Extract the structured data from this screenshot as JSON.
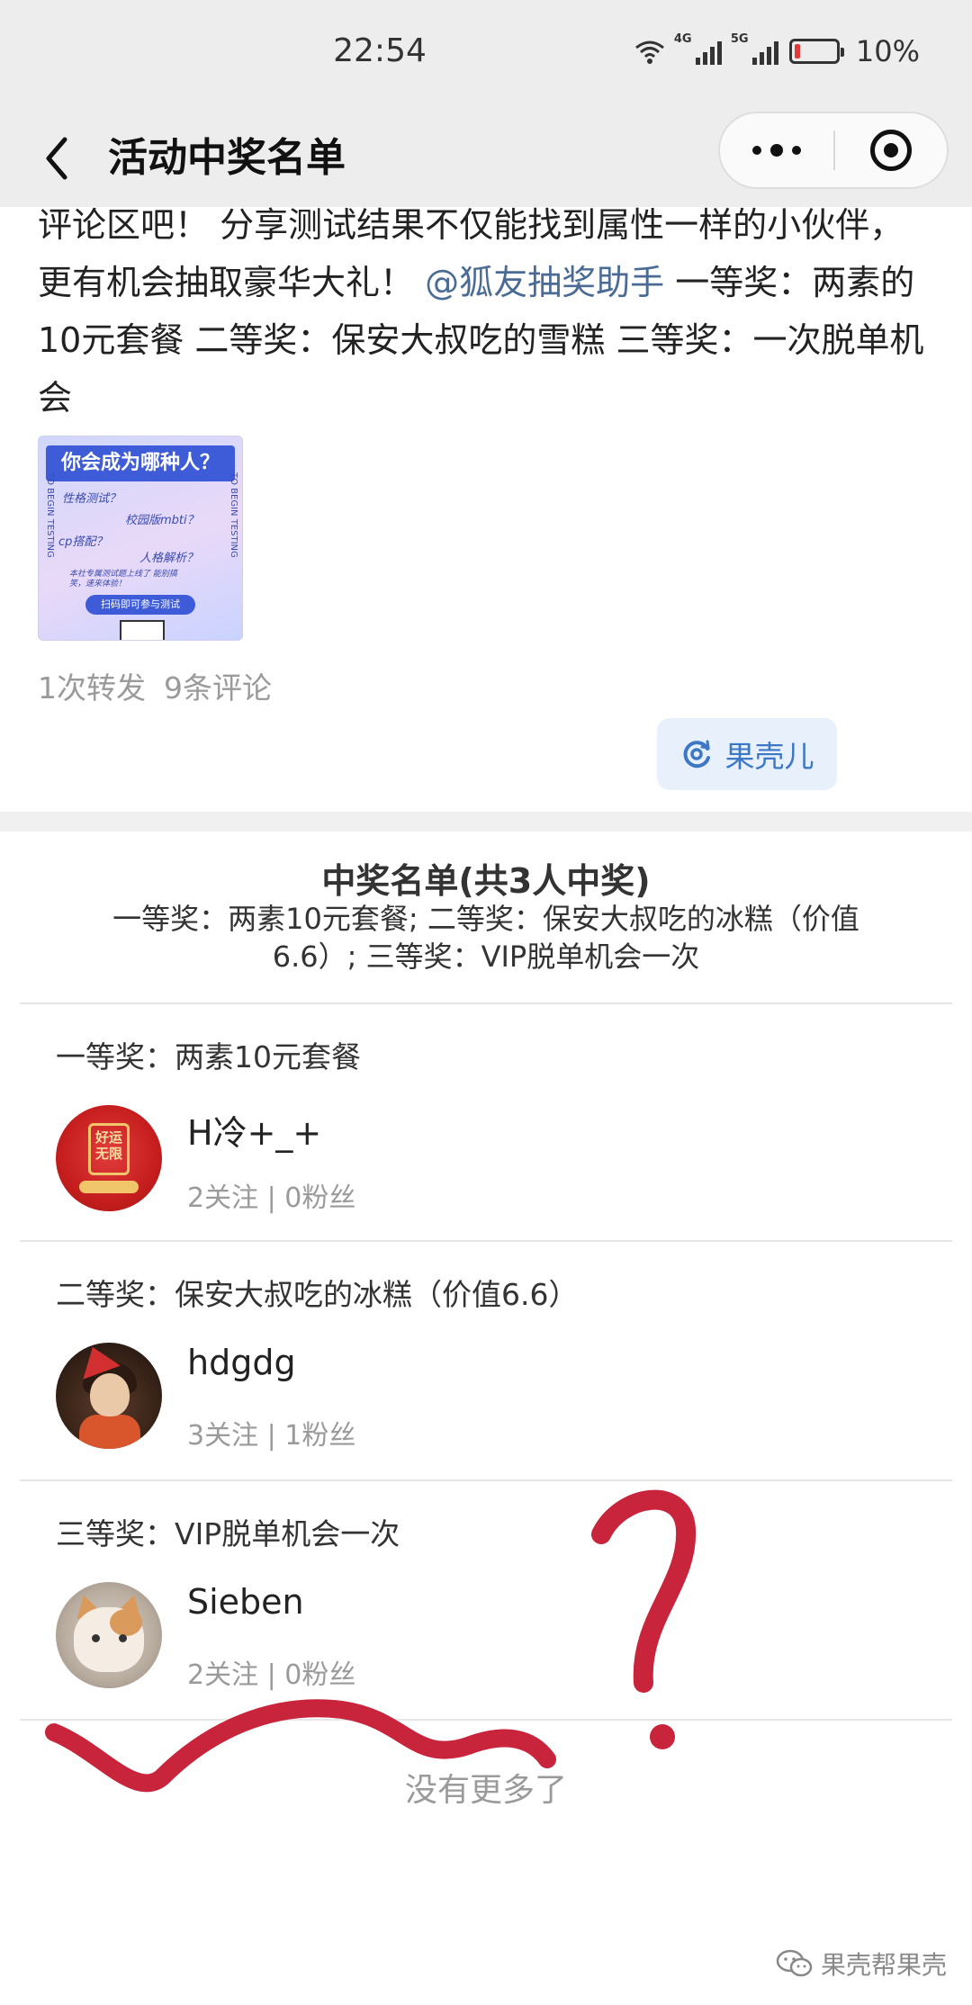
{
  "status_bar": {
    "time": "22:54",
    "signal1": "4G",
    "signal2": "5G",
    "battery": "10%",
    "battery_level": 0.1
  },
  "navbar": {
    "title": "活动中奖名单",
    "back_icon": "chevron-left-icon",
    "more_icon": "more-dots-icon",
    "close_icon": "target-icon"
  },
  "post": {
    "text_before": "评论区吧！ 分享测试结果不仅能找到属性一样的小伙伴，更有机会抽取豪华大礼！ ",
    "mention": "@狐友抽奖助手",
    "text_after": " 一等奖：两素的10元套餐 二等奖：保安大叔吃的雪糕 三等奖：一次脱单机会",
    "image": {
      "title": "你会成为哪种人？",
      "line1": "性格测试？",
      "line2": "校园版mbti？",
      "line3": "cp搭配？",
      "line4": "人格解析？",
      "side_left": "TO BEGIN TESTING",
      "side_right": "TO BEGIN TESTING",
      "note": "本社专属测试题上线了 能别搞笑，速来体验！",
      "button": "扫码即可参与测试"
    },
    "reposts": "1次转发",
    "comments": "9条评论",
    "tag": "果壳儿",
    "tag_icon": "refresh-icon"
  },
  "winners": {
    "title": "中奖名单(共3人中奖)",
    "summary": "一等奖：两素10元套餐; 二等奖：保安大叔吃的冰糕（价值6.6）; 三等奖：VIP脱单机会一次",
    "items": [
      {
        "prize": "一等奖：两素10元套餐",
        "name": "H冷+_+",
        "stats": "2关注 | 0粉丝",
        "avatar_text": "好运无限"
      },
      {
        "prize": "二等奖：保安大叔吃的冰糕（价值6.6）",
        "name": "hdgdg",
        "stats": "3关注 | 1粉丝"
      },
      {
        "prize": "三等奖：VIP脱单机会一次",
        "name": "Sieben",
        "stats": "2关注 | 0粉丝"
      }
    ],
    "no_more": "没有更多了"
  },
  "watermark": {
    "icon": "wechat-icon",
    "text": "果壳帮果壳"
  },
  "colors": {
    "header_bg": "#ededed",
    "mention": "#4a6b94",
    "tag_bg": "#e7f0fb",
    "tag_text": "#3d78c6",
    "scribble": "#c8243c"
  }
}
